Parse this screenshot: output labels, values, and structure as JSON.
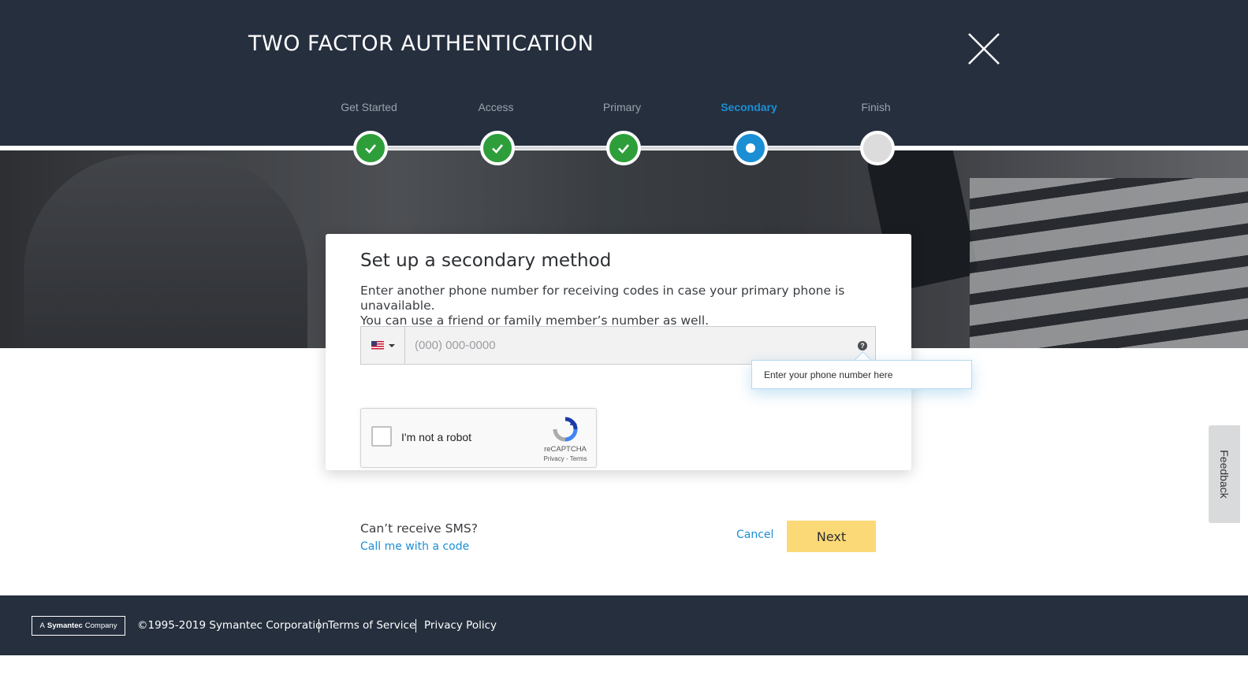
{
  "header": {
    "title": "TWO FACTOR AUTHENTICATION",
    "close_icon": "close-icon"
  },
  "steps": [
    {
      "label": "Get Started",
      "status": "done"
    },
    {
      "label": "Access",
      "status": "done"
    },
    {
      "label": "Primary",
      "status": "done"
    },
    {
      "label": "Secondary",
      "status": "current"
    },
    {
      "label": "Finish",
      "status": "todo"
    }
  ],
  "card": {
    "title": "Set up a secondary method",
    "description_line1": "Enter another phone number for receiving codes in case your primary phone is unavailable.",
    "description_line2": "You can use a friend or family member’s number as well.",
    "country_flag_icon": "us-flag-icon",
    "phone_placeholder": "(000) 000-0000",
    "phone_value": "",
    "help_icon": "question-circle-icon",
    "tooltip": "Enter your phone number here"
  },
  "recaptcha": {
    "label": "I'm not a robot",
    "brand": "reCAPTCHA",
    "links": "Privacy - Terms"
  },
  "alt_method": {
    "question": "Can’t receive SMS?",
    "link": "Call me with a code"
  },
  "actions": {
    "cancel": "Cancel",
    "next": "Next"
  },
  "feedback": {
    "label": "Feedback"
  },
  "footer": {
    "badge_prefix": "A",
    "badge_brand": "Symantec",
    "badge_suffix": "Company",
    "copyright": "©1995-2019 Symantec Corporation",
    "terms": "Terms of Service",
    "privacy": "Privacy Policy"
  },
  "colors": {
    "header_bg": "#252f3e",
    "accent_blue": "#1b8fd4",
    "done_green": "#2e9e3a",
    "next_button": "#fcd977"
  }
}
